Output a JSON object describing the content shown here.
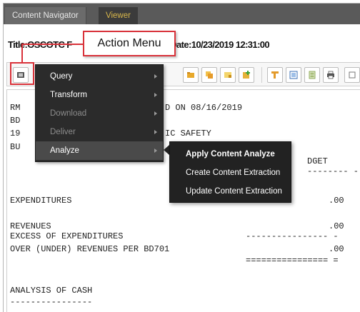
{
  "tabs": [
    {
      "label": "Content Navigator"
    },
    {
      "label": "Viewer"
    }
  ],
  "document": {
    "title_start": "Title:OSCOTC F",
    "title_end": "5 Date:10/23/2019 12:31:00"
  },
  "callout": {
    "label": "Action Menu"
  },
  "action_menu": {
    "items": [
      {
        "label": "Query"
      },
      {
        "label": "Transform"
      },
      {
        "label": "Download"
      },
      {
        "label": "Deliver"
      },
      {
        "label": "Analyze"
      }
    ]
  },
  "analyze_submenu": {
    "items": [
      {
        "label": "Apply Content Analyze"
      },
      {
        "label": "Create Content Extraction"
      },
      {
        "label": "Update Content Extraction"
      }
    ]
  },
  "report": {
    "line_rm": "RM",
    "line_on_date": "D ON 08/16/2019",
    "line_bd": "BD",
    "line_19": "19",
    "line_safety": "IC SAFETY",
    "line_bu": "BU",
    "line_dget": "DGET",
    "dashes_header": "-------- -",
    "expenditures_label": "EXPENDITURES",
    "expenditures_value": ".00",
    "revenues_label": "REVENUES",
    "revenues_value": ".00",
    "excess_label": "EXCESS OF EXPENDITURES",
    "excess_dashes": "---------------- -",
    "over_label": "OVER (UNDER) REVENUES PER BD701",
    "over_value": ".00",
    "over_equals": "================ =",
    "cash_label": "ANALYSIS OF CASH",
    "cash_dashes": "----------------"
  },
  "colors": {
    "accent_red": "#d9323a",
    "menu_bg": "#2b2b2b",
    "tab_bar": "#5a5a5a",
    "viewer_tab_text": "#d7b64b"
  }
}
